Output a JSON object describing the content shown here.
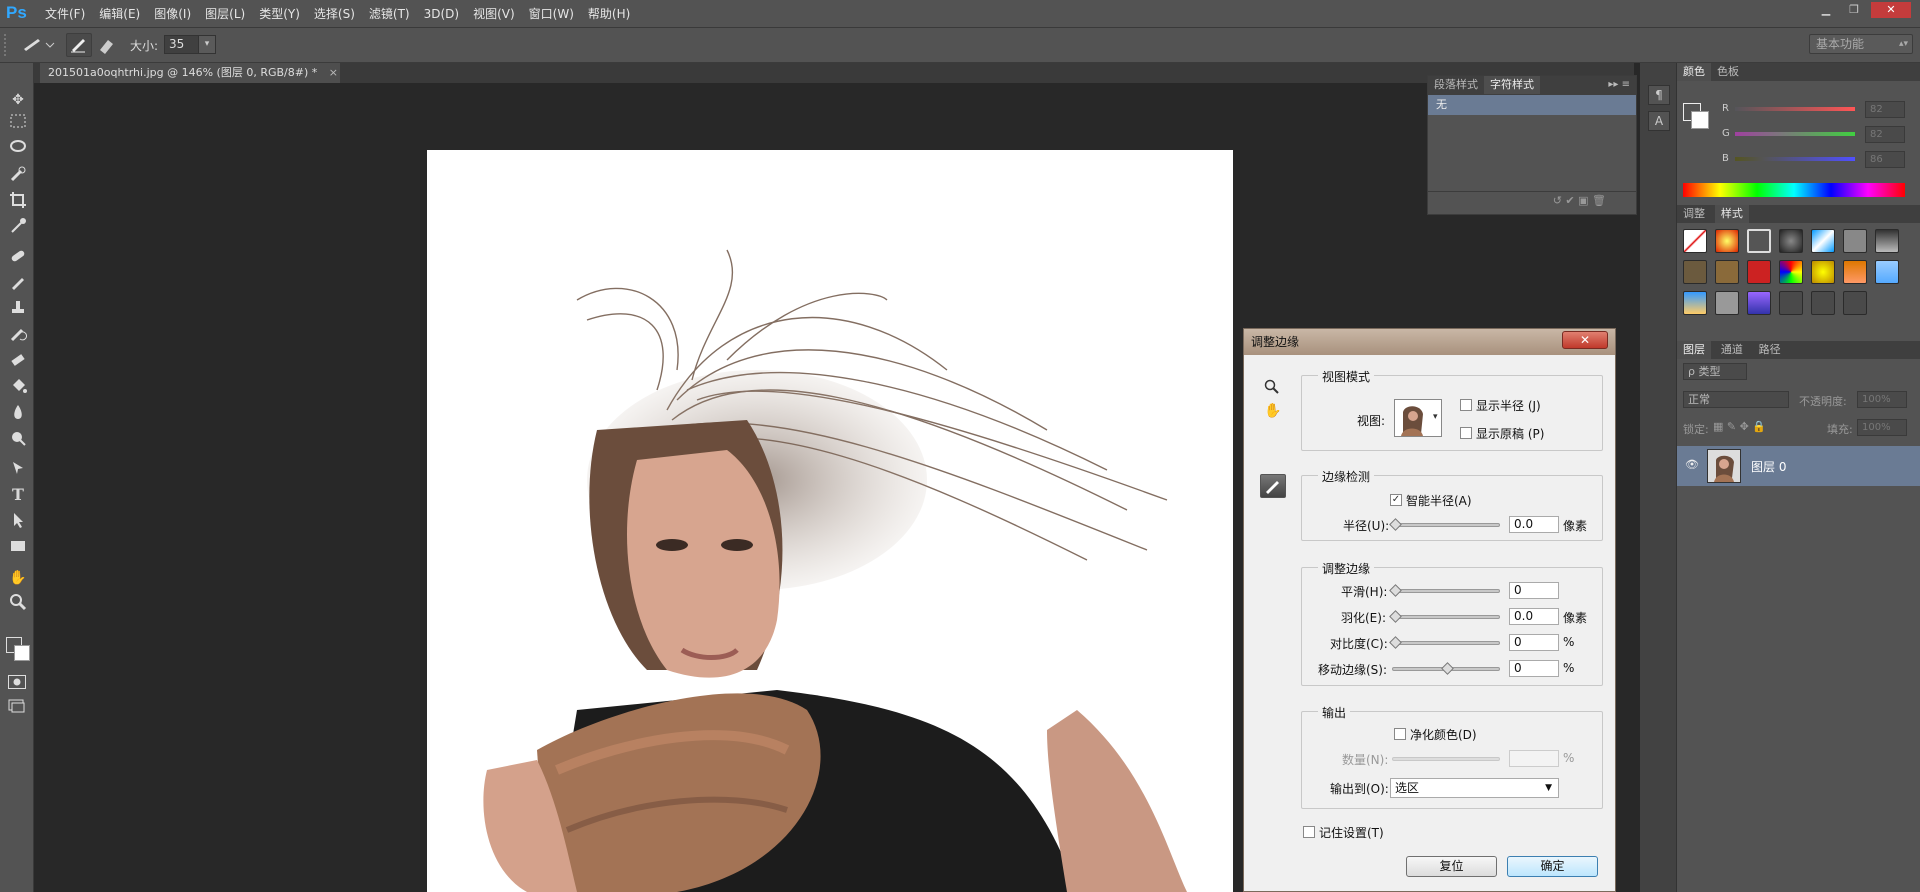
{
  "app": {
    "logo": "Ps"
  },
  "menus": [
    "文件(F)",
    "编辑(E)",
    "图像(I)",
    "图层(L)",
    "类型(Y)",
    "选择(S)",
    "滤镜(T)",
    "3D(D)",
    "视图(V)",
    "窗口(W)",
    "帮助(H)"
  ],
  "window_controls": {
    "minimize": "▁",
    "restore": "❐",
    "close": "✕"
  },
  "options": {
    "size_label": "大小:",
    "size_value": "35",
    "workspace": "基本功能"
  },
  "document": {
    "tab_title": "201501a0oqhtrhi.jpg @ 146% (图层 0, RGB/8#) *",
    "close": "×"
  },
  "char_panel": {
    "tabs": [
      "段落样式",
      "字符样式"
    ],
    "active_tab": 1,
    "items": [
      "无"
    ]
  },
  "color_panel": {
    "tabs": [
      "颜色",
      "色板"
    ],
    "R": "82",
    "G": "82",
    "B": "86"
  },
  "styles_panel": {
    "tabs": [
      "调整",
      "样式"
    ],
    "active_tab": 1
  },
  "layers_panel": {
    "tabs": [
      "图层",
      "通道",
      "路径"
    ],
    "filter_kind": "ρ 类型",
    "blend_mode": "正常",
    "opacity_label": "不透明度:",
    "opacity_value": "100%",
    "lock_label": "锁定:",
    "fill_label": "填充:",
    "fill_value": "100%",
    "layer_name": "图层 0"
  },
  "dialog": {
    "title": "调整边缘",
    "view_mode": {
      "title": "视图模式",
      "view_label": "视图:",
      "show_radius": "显示半径 (J)",
      "show_original": "显示原稿 (P)"
    },
    "edge_detection": {
      "title": "边缘检测",
      "smart_radius": "智能半径(A)",
      "smart_radius_checked": true,
      "radius_label": "半径(U):",
      "radius_value": "0.0",
      "radius_unit": "像素"
    },
    "adjust_edge": {
      "title": "调整边缘",
      "smooth_label": "平滑(H):",
      "smooth_value": "0",
      "feather_label": "羽化(E):",
      "feather_value": "0.0",
      "feather_unit": "像素",
      "contrast_label": "对比度(C):",
      "contrast_value": "0",
      "contrast_unit": "%",
      "shift_label": "移动边缘(S):",
      "shift_value": "0",
      "shift_unit": "%"
    },
    "output": {
      "title": "输出",
      "decontaminate": "净化颜色(D)",
      "amount_label": "数量(N):",
      "amount_unit": "%",
      "output_to_label": "输出到(O):",
      "output_to_value": "选区"
    },
    "remember": "记住设置(T)",
    "reset_button": "复位",
    "ok_button": "确定"
  }
}
